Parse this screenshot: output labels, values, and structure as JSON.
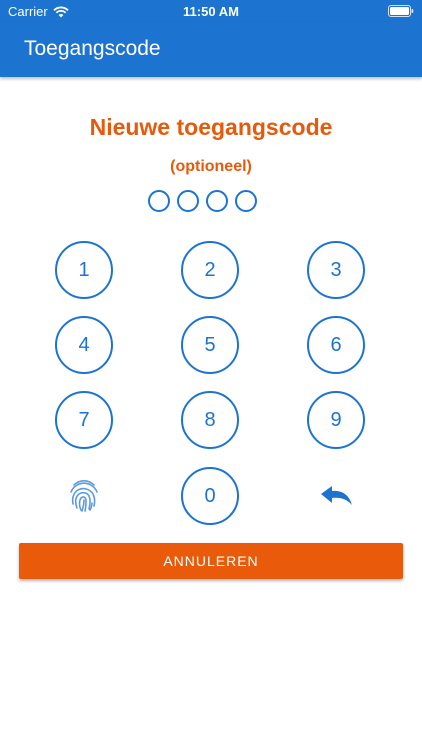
{
  "status_bar": {
    "carrier": "Carrier",
    "time": "11:50 AM"
  },
  "nav": {
    "title": "Toegangscode"
  },
  "pin": {
    "title": "Nieuwe toegangscode",
    "subtitle": "(optioneel)",
    "dot_count": 4
  },
  "keypad": {
    "k1": "1",
    "k2": "2",
    "k3": "3",
    "k4": "4",
    "k5": "5",
    "k6": "6",
    "k7": "7",
    "k8": "8",
    "k9": "9",
    "k0": "0"
  },
  "icons": {
    "biometric": "fingerprint-icon",
    "undo": "undo-icon"
  },
  "actions": {
    "cancel_label": "ANNULEREN"
  },
  "colors": {
    "primary": "#1c74d0",
    "accent": "#e65a0c",
    "background": "#ffffff"
  }
}
